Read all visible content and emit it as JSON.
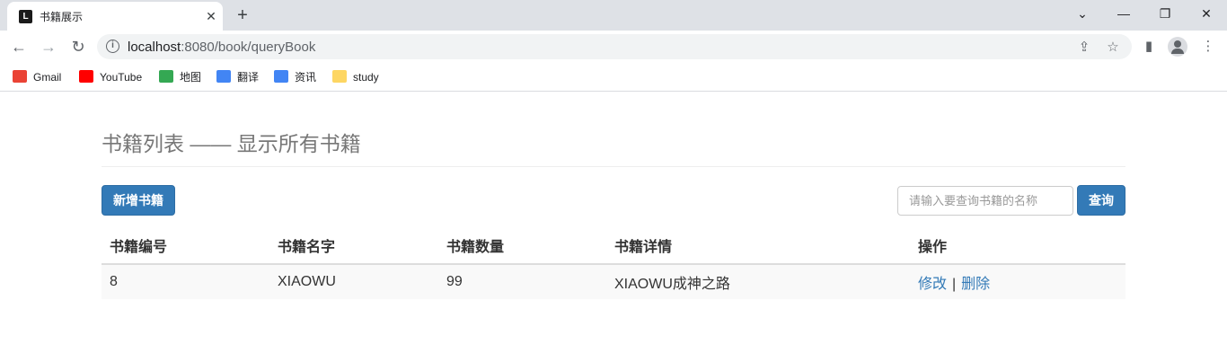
{
  "browser": {
    "tab_title": "书籍展示",
    "url_host": "localhost",
    "url_rest": ":8080/book/queryBook",
    "bookmarks": [
      {
        "label": "Gmail",
        "icon": "gmail-icon",
        "color": "#ea4335"
      },
      {
        "label": "YouTube",
        "icon": "youtube-icon",
        "color": "#ff0000"
      },
      {
        "label": "地图",
        "icon": "maps-icon",
        "color": "#34a853"
      },
      {
        "label": "翻译",
        "icon": "translate-icon",
        "color": "#4285f4"
      },
      {
        "label": "资讯",
        "icon": "news-icon",
        "color": "#4285f4"
      },
      {
        "label": "study",
        "icon": "folder-icon",
        "color": "#fdd663"
      }
    ]
  },
  "page": {
    "title": "书籍列表 —— 显示所有书籍",
    "add_button": "新增书籍",
    "search_placeholder": "请输入要查询书籍的名称",
    "query_button": "查询",
    "table": {
      "headers": [
        "书籍编号",
        "书籍名字",
        "书籍数量",
        "书籍详情",
        "操作"
      ],
      "rows": [
        {
          "id": "8",
          "name": "XIAOWU",
          "count": "99",
          "detail": "XIAOWU成神之路",
          "edit": "修改",
          "delete": "删除"
        }
      ]
    }
  },
  "colors": {
    "primary": "#337ab7",
    "title_gray": "#777777"
  }
}
